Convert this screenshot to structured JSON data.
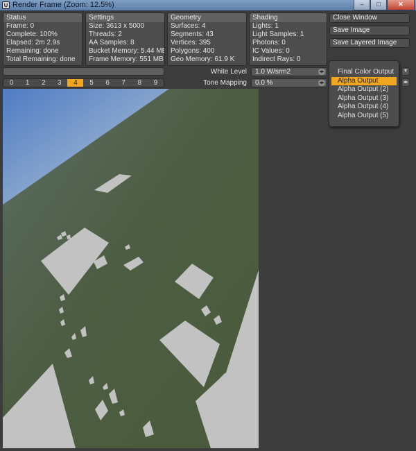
{
  "window": {
    "title": "Render Frame (Zoom: 12.5%)",
    "controls": {
      "minimize": "–",
      "maximize": "□",
      "close": "✕"
    }
  },
  "panels": {
    "status": {
      "header": "Status",
      "rows": [
        "Frame: 0",
        "Complete: 100%",
        "Elapsed: 2m 2.9s",
        "Remaining: done",
        "Total Remaining: done"
      ]
    },
    "settings": {
      "header": "Settings",
      "rows": [
        "Size: 3613 x 5000",
        "Threads: 2",
        "AA Samples: 8",
        "Bucket Memory: 5.44 MB",
        "Frame Memory: 551 MB"
      ]
    },
    "geometry": {
      "header": "Geometry",
      "rows": [
        "Surfaces: 4",
        "Segments: 43",
        "Vertices: 395",
        "Polygons: 400",
        "Geo Memory: 61.9 K"
      ]
    },
    "shading": {
      "header": "Shading",
      "rows": [
        "Lights: 1",
        "Light Samples: 1",
        "Photons: 0",
        "IC Values: 0",
        "Indirect Rays: 0"
      ]
    }
  },
  "buttons": {
    "close_window": "Close Window",
    "save_image": "Save Image",
    "save_layered_image": "Save Layered Image"
  },
  "progress": {
    "complete": 1.0
  },
  "buckets": {
    "items": [
      "0",
      "1",
      "2",
      "3",
      "4",
      "5",
      "6",
      "7",
      "8",
      "9"
    ],
    "active_index": 4
  },
  "controls": {
    "white_level": {
      "label": "White Level",
      "value": "1.0 W/srm2"
    },
    "tone_mapping": {
      "label": "Tone Mapping",
      "value": "0.0 %"
    }
  },
  "output_menu": {
    "items": [
      "Final Color Output",
      "Alpha Output",
      "Alpha Output (2)",
      "Alpha Output (3)",
      "Alpha Output (4)",
      "Alpha Output (5)"
    ],
    "selected_index": 1
  },
  "colors": {
    "accent": "#f2a51f",
    "ground": "#4b5b3d",
    "sky_top": "#4f7cc4",
    "tiles": "#c2c2c2",
    "panel_header": "#616161"
  },
  "icons": {
    "app": "render-frame-icon",
    "nudge": "nudge-arrows-icon",
    "dropdown": "dropdown-arrow-icon"
  }
}
